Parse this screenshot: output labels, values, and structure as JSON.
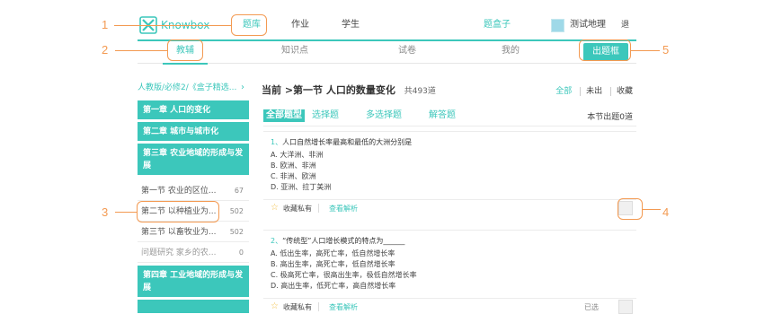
{
  "brand": {
    "name": "Knowbox",
    "color": "#3cc7bb"
  },
  "topnav": {
    "tiku": "题库",
    "zuoye": "作业",
    "xuesheng": "学生",
    "hezi": "题盒子",
    "username": "测试地理",
    "logout": "退出"
  },
  "subnav": {
    "jiaofu": "教辅",
    "zhishidian": "知识点",
    "shijuan": "试卷",
    "wode": "我的",
    "chuti": "出题框"
  },
  "sidebar": {
    "book": "人教版/必修2/《盒子精选...",
    "chapters": [
      {
        "label": "第一章 人口的变化"
      },
      {
        "label": "第二章 城市与城市化"
      },
      {
        "label": "第三章 农业地域的形成与发展"
      }
    ],
    "sections": [
      {
        "label": "第一节 农业的区位...",
        "count": "67"
      },
      {
        "label": "第二节 以种植业为...",
        "count": "502"
      },
      {
        "label": "第三节 以畜牧业为...",
        "count": "502"
      },
      {
        "label": "问题研究 家乡的农...",
        "count": "0"
      }
    ],
    "chapter4": {
      "label": "第四章 工业地域的形成与发展"
    }
  },
  "main": {
    "breadcrumb": "当前 >第一节 人口的数量变化",
    "total": "共493道",
    "filters": {
      "all": "全部",
      "undone": "未出",
      "favorite": "收藏"
    },
    "types": {
      "all": "全部题型",
      "single": "选择题",
      "multi": "多选择题",
      "answer": "解答题"
    },
    "section_count": "本节出题0道",
    "questions": [
      {
        "num": "1、",
        "stem": "人口自然增长率最高和最低的大洲分别是",
        "options": [
          "A. 大洋洲、非洲",
          "B. 欧洲、非洲",
          "C. 非洲、欧洲",
          "D. 亚洲、拉丁美洲"
        ],
        "fav": "收藏私有",
        "analysis": "查看解析"
      },
      {
        "num": "2、",
        "stem": "“传统型”人口增长模式的特点为______",
        "options": [
          "A. 低出生率，高死亡率，低自然增长率",
          "B. 高出生率，高死亡率，低自然增长率",
          "C. 极高死亡率，很高出生率，极低自然增长率",
          "D. 高出生率，低死亡率，高自然增长率"
        ],
        "fav": "收藏私有",
        "analysis": "查看解析",
        "selected": "已选"
      }
    ]
  },
  "callouts": {
    "c1": "1",
    "c2": "2",
    "c3": "3",
    "c4": "4",
    "c5": "5"
  }
}
